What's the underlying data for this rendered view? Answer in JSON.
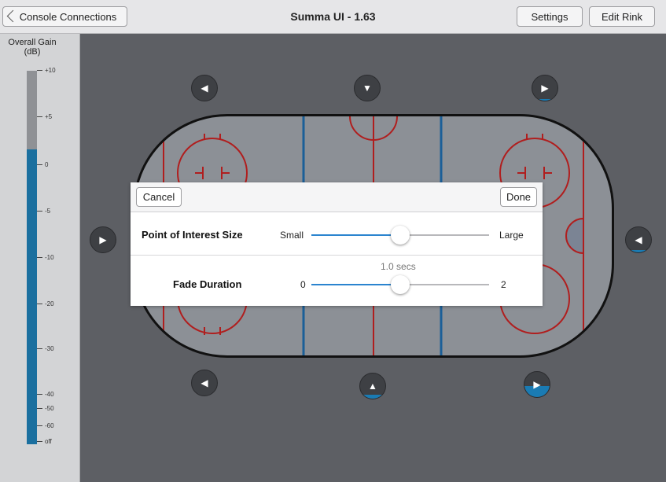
{
  "header": {
    "back_label": "Console Connections",
    "title": "Summa UI - 1.63",
    "settings_label": "Settings",
    "edit_rink_label": "Edit Rink"
  },
  "gain_meter": {
    "title_line1": "Overall Gain",
    "title_line2": "(dB)",
    "level_fraction": 0.79,
    "fill_color": "#1a6f9f",
    "ticks": [
      "+10",
      "+5",
      "0",
      "-5",
      "-10",
      "-20",
      "-30",
      "-40",
      "-50",
      "-60",
      "off"
    ]
  },
  "arrow_buttons": [
    {
      "name": "top-left",
      "direction": "left",
      "fill": 0
    },
    {
      "name": "top-center",
      "direction": "down",
      "fill": 0
    },
    {
      "name": "top-right",
      "direction": "right",
      "fill": 0.05
    },
    {
      "name": "left",
      "direction": "right",
      "fill": 0
    },
    {
      "name": "right",
      "direction": "left",
      "fill": 0.08
    },
    {
      "name": "bottom-left",
      "direction": "down-left",
      "fill": 0
    },
    {
      "name": "bottom-center",
      "direction": "up",
      "fill": 0.15
    },
    {
      "name": "bottom-right",
      "direction": "right",
      "fill": 0.45
    }
  ],
  "rink_colors": {
    "board": "#111111",
    "ice": "#8c9096",
    "red": "#b01e1e",
    "blue": "#1b5f98"
  },
  "dialog": {
    "cancel_label": "Cancel",
    "done_label": "Done",
    "poi": {
      "label": "Point of Interest Size",
      "min_label": "Small",
      "max_label": "Large",
      "value_fraction": 0.5
    },
    "fade": {
      "label": "Fade Duration",
      "min_label": "0",
      "max_label": "2",
      "readout": "1.0 secs",
      "value": 1.0,
      "min": 0,
      "max": 2
    }
  }
}
